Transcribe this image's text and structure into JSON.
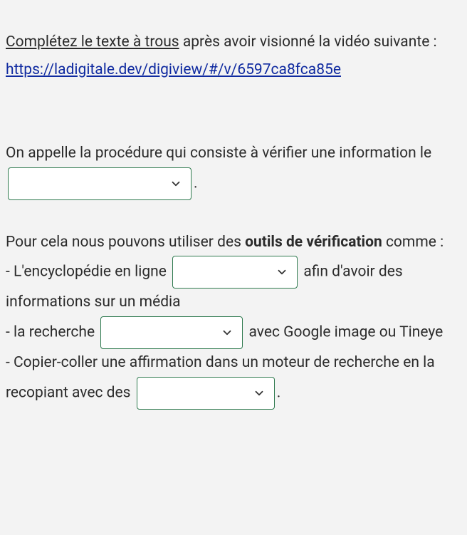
{
  "intro": {
    "underlined": "Complétez le texte à trous",
    "after": " après avoir visionné la vidéo suivante :",
    "link_text": "https://ladigitale.dev/digiview/#/v/6597ca8fca85e",
    "link_href": "https://ladigitale.dev/digiview/#/v/6597ca8fca85e"
  },
  "p1": {
    "before": "On appelle la procédure qui consiste à vérifier une information le ",
    "after": "."
  },
  "p2": {
    "t1": "Pour cela nous pouvons utiliser des ",
    "bold": "outils de vérification",
    "t2": " comme :"
  },
  "b1": {
    "before": "- L'encyclopédie en ligne ",
    "after": " afin d'avoir des informations sur un média"
  },
  "b2": {
    "before": "- la recherche ",
    "after": " avec Google image ou Tineye"
  },
  "b3": {
    "before": "- Copier-coller une affirmation dans un moteur de recherche en la recopiant avec des ",
    "after": "."
  },
  "selects": {
    "s1": "",
    "s2": "",
    "s3": "",
    "s4": ""
  }
}
